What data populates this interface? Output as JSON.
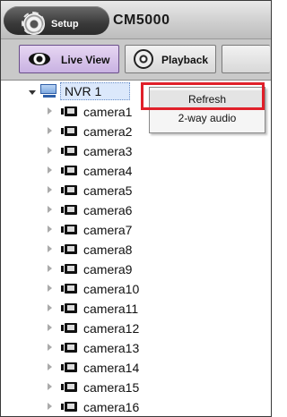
{
  "header": {
    "setup_label": "Setup",
    "app_title": "CM5000"
  },
  "toolbar": {
    "live_view_label": "Live View",
    "playback_label": "Playback",
    "active_tab": "Live View",
    "active_color": "#c9b2e2"
  },
  "tree": {
    "root_label": "NVR 1",
    "root_expanded": true,
    "cameras": [
      "camera1",
      "camera2",
      "camera3",
      "camera4",
      "camera5",
      "camera6",
      "camera7",
      "camera8",
      "camera9",
      "camera10",
      "camera11",
      "camera12",
      "camera13",
      "camera14",
      "camera15",
      "camera16"
    ]
  },
  "context_menu": {
    "items": [
      "Refresh",
      "2-way audio"
    ],
    "highlighted_item": "Refresh",
    "highlight_color": "#e0202a"
  },
  "icons": {
    "setup": "gear-icon",
    "live_view": "eye-icon",
    "playback": "film-reel-icon",
    "nvr": "monitor-icon",
    "camera": "camera-icon"
  }
}
